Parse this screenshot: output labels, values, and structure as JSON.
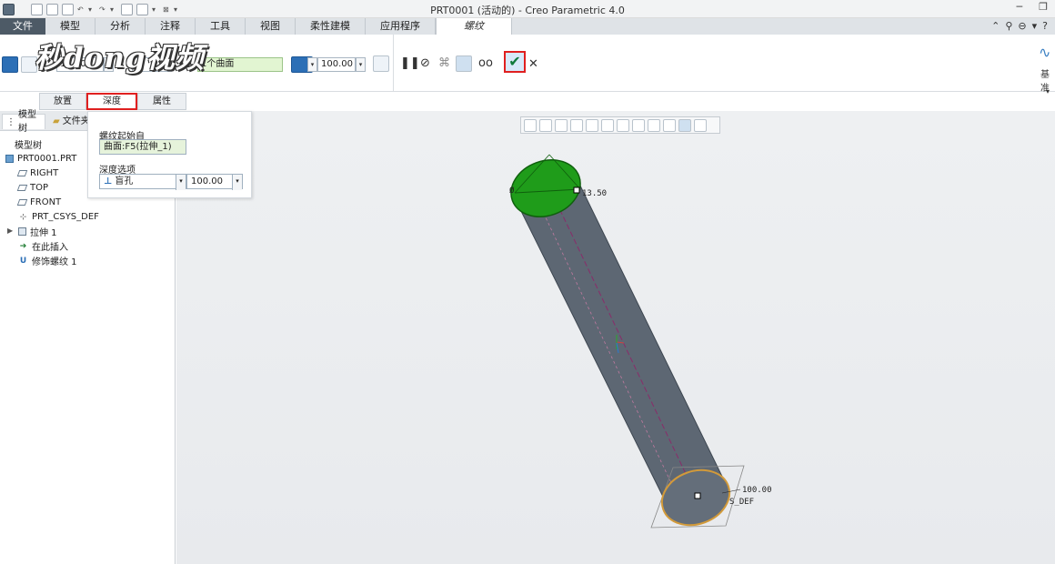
{
  "window": {
    "title": "PRT0001 (活动的) - Creo Parametric 4.0"
  },
  "ribbon_tabs": [
    {
      "label": "文件"
    },
    {
      "label": "模型"
    },
    {
      "label": "分析"
    },
    {
      "label": "注释"
    },
    {
      "label": "工具"
    },
    {
      "label": "视图"
    },
    {
      "label": "柔性建模"
    },
    {
      "label": "应用程序"
    },
    {
      "label": "螺纹"
    }
  ],
  "active_ribbon_tab": "螺纹",
  "watermark": "秒dong视频",
  "ribbon": {
    "diameter_value": "13.50",
    "surface_ref": "1个曲面",
    "depth_value": "100.00",
    "base_label": "基准"
  },
  "sub_tabs": [
    {
      "label": "放置"
    },
    {
      "label": "深度"
    },
    {
      "label": "属性"
    }
  ],
  "active_sub_tab": "深度",
  "depth_panel": {
    "thread_start_label": "螺纹起始自",
    "thread_start_value": "曲面:F5(拉伸_1)",
    "depth_option_label": "深度选项",
    "depth_option_value": "盲孔",
    "depth_value": "100.00"
  },
  "left_panel": {
    "tabs": [
      {
        "label": "模型树"
      },
      {
        "label": "文件夹"
      }
    ],
    "tree_header": "模型树",
    "tree_items": [
      {
        "label": "PRT0001.PRT",
        "icon": "part-icon"
      },
      {
        "label": "RIGHT",
        "icon": "datum-plane-icon"
      },
      {
        "label": "TOP",
        "icon": "datum-plane-icon"
      },
      {
        "label": "FRONT",
        "icon": "datum-plane-icon"
      },
      {
        "label": "PRT_CSYS_DEF",
        "icon": "csys-icon"
      },
      {
        "label": "拉伸 1",
        "icon": "extrude-icon"
      },
      {
        "label": "在此插入",
        "icon": "insert-here-icon"
      },
      {
        "label": "修饰螺纹 1",
        "icon": "thread-icon"
      }
    ]
  },
  "graphics": {
    "dim_diameter": "13.50",
    "dim_depth": "100.00",
    "csys_label": "S_DEF"
  },
  "colors": {
    "file_tab": "#4d5a66",
    "highlight": "#e02020",
    "cylinder": "#5e6874",
    "cap": "#1f9c1a",
    "bottom_cap": "#d29a3a"
  }
}
